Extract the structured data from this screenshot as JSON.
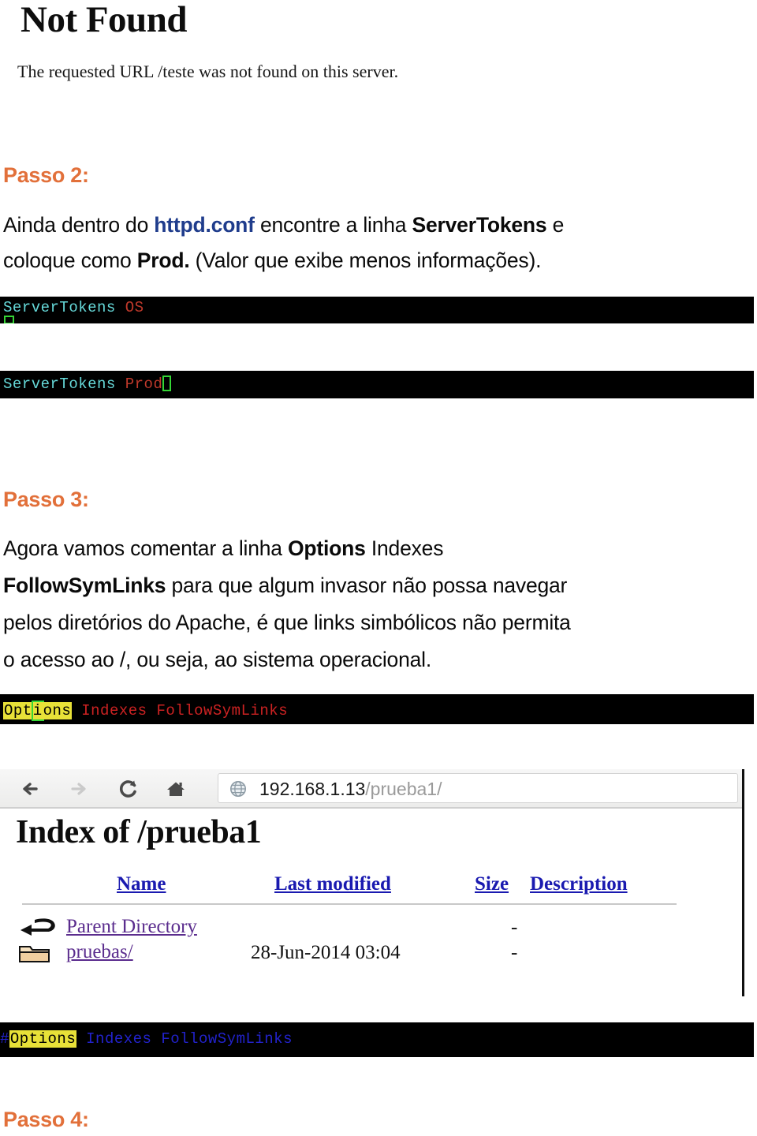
{
  "error_page": {
    "title": "Not Found",
    "message": "The requested URL /teste was not found on this server."
  },
  "step2": {
    "heading": "Passo 2:",
    "line1_a": "Ainda dentro do ",
    "line1_b": "httpd.conf",
    "line1_c": " encontre a linha ",
    "line1_d": "ServerTokens",
    "line1_e": " e",
    "line2_a": "coloque como ",
    "line2_b": "Prod.",
    "line2_c": " (Valor que exibe menos informações)."
  },
  "terminal_before": {
    "directive": "ServerTokens",
    "value": "OS",
    "cursor": "block-cursor"
  },
  "terminal_after": {
    "directive": "ServerTokens",
    "value": "Prod",
    "cursor": "block-cursor"
  },
  "step3": {
    "heading": "Passo 3:",
    "line1_a": "Agora vamos comentar a linha ",
    "line1_b": "Options",
    "line1_c": " Indexes",
    "line2_a": "FollowSymLinks",
    "line2_b": " para que algum invasor não possa navegar",
    "line3": "pelos diretórios do Apache, é que links simbólicos não permita",
    "line4": "o acesso ao /, ou seja, ao sistema operacional."
  },
  "terminal_options_on": {
    "highlight_pre": "Opt",
    "highlight_cursor": "i",
    "highlight_post": "ons",
    "rest": "Indexes FollowSymLinks"
  },
  "terminal_options_commented": {
    "comment_char": "#",
    "highlight": "Options",
    "rest": "Indexes FollowSymLinks"
  },
  "browser": {
    "back_icon": "back-arrow-icon",
    "forward_icon": "forward-arrow-icon",
    "reload_icon": "reload-icon",
    "home_icon": "home-icon",
    "site_icon": "globe-icon",
    "url_host": "192.168.1.13",
    "url_path": "/prueba1/",
    "page_title": "Index of /prueba1",
    "columns": [
      "Name",
      "Last modified",
      "Size",
      "Description"
    ],
    "rows": [
      {
        "icon": "parent-directory-icon",
        "name": "Parent Directory",
        "modified": "",
        "size": "-"
      },
      {
        "icon": "folder-icon",
        "name": "pruebas/",
        "modified": "28-Jun-2014 03:04",
        "size": "-"
      }
    ]
  },
  "step4": {
    "heading": "Passo 4:"
  },
  "colors": {
    "heading_orange": "#E2703A",
    "link_blue": "#1F3C8C",
    "terminal_bg": "#000000",
    "terminal_cyan": "#66D9D9",
    "terminal_red": "#C0392B",
    "terminal_blue": "#2222CC",
    "highlight_yellow": "#E8E138",
    "cursor_green": "#35D635"
  }
}
